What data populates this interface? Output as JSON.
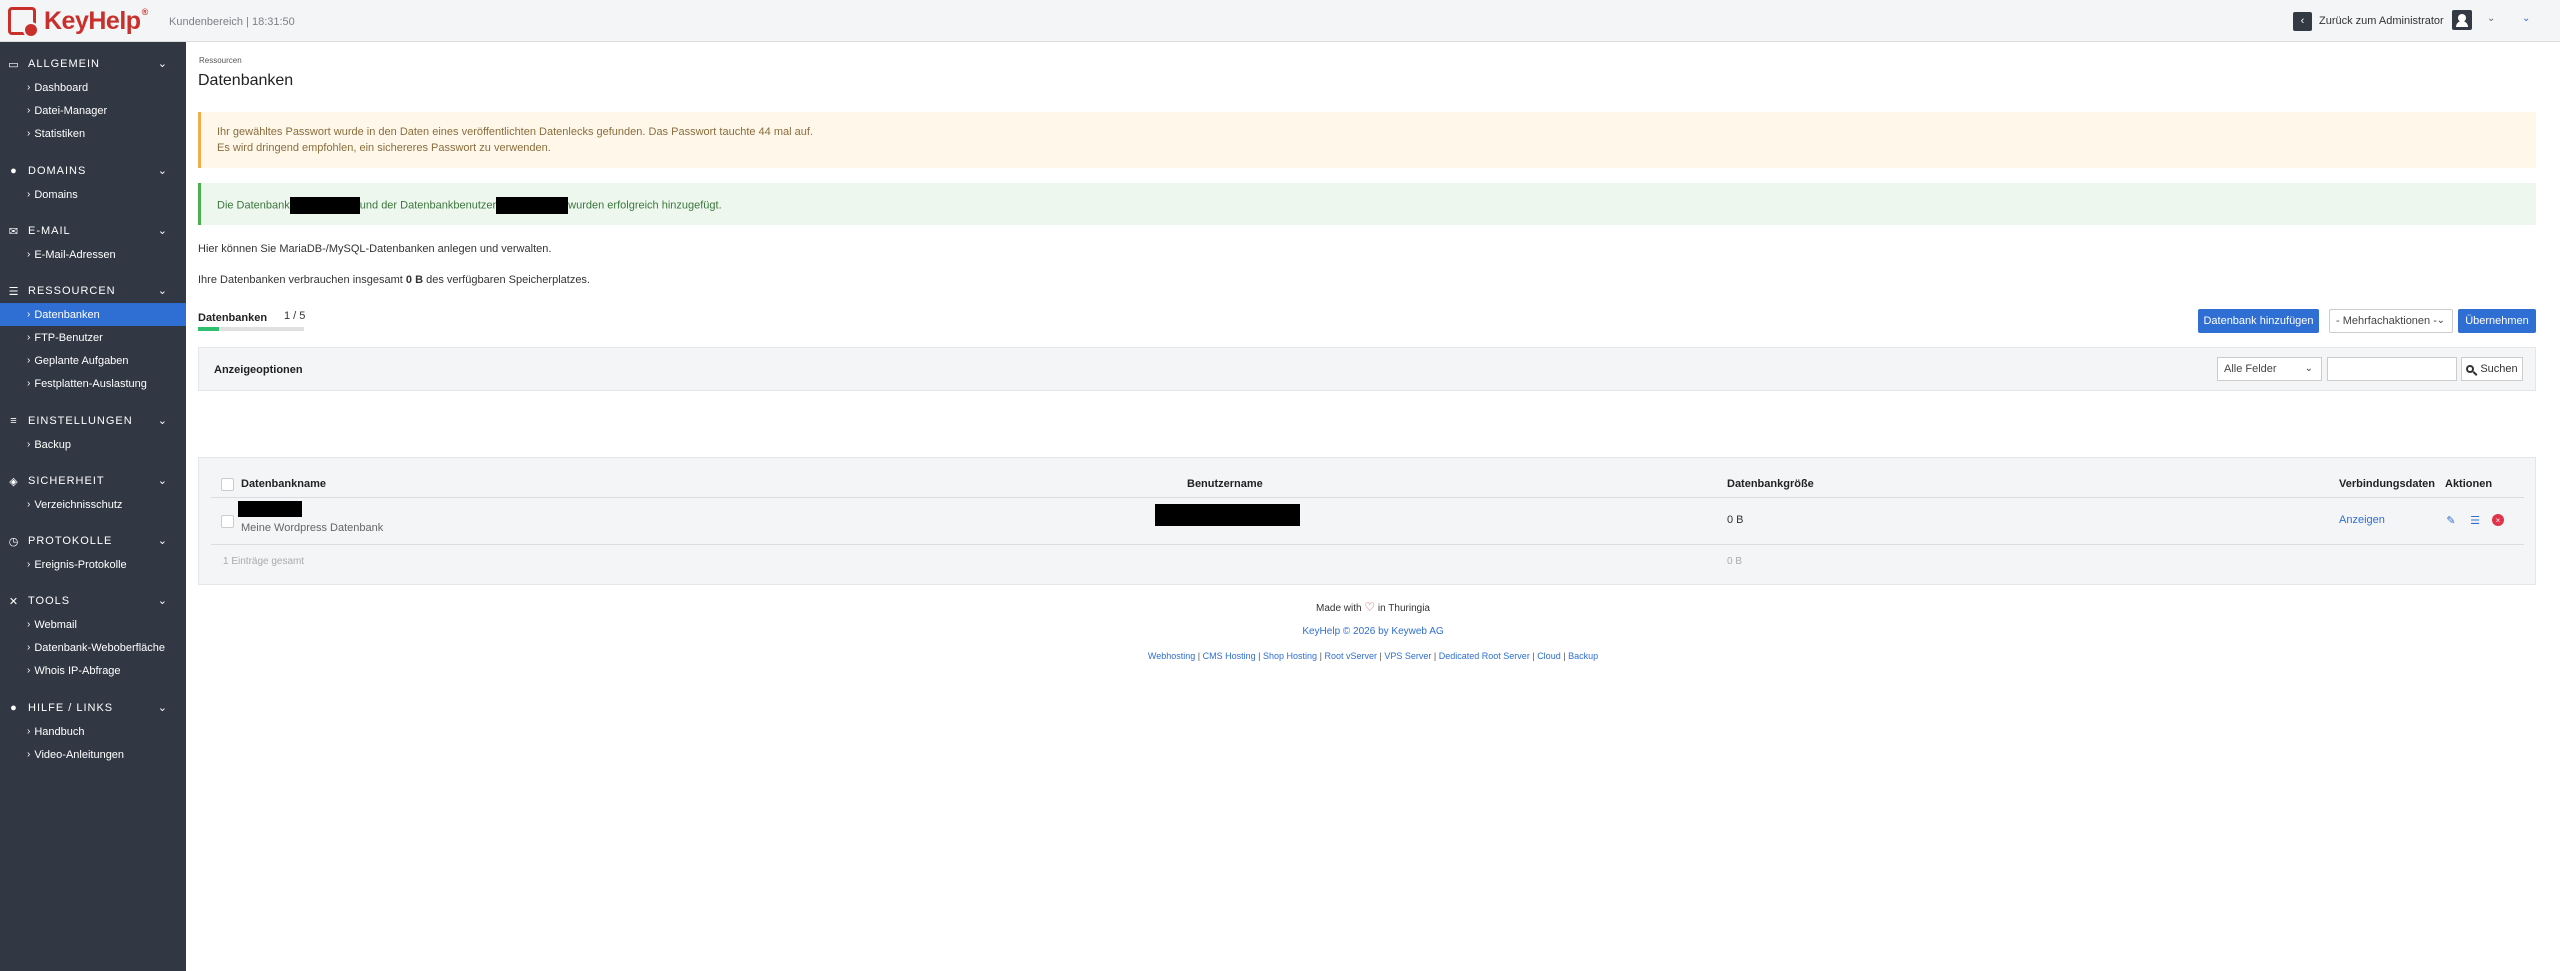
{
  "topbar": {
    "logo_text_1": "Key",
    "logo_text_2": "Help",
    "logo_reg": "®",
    "area_info": "Kundenbereich | 18:31:50",
    "back_admin": "Zurück zum Administrator"
  },
  "sidebar": {
    "groups": [
      {
        "title": "Allgemein",
        "icon": "monitor-icon",
        "items": [
          "Dashboard",
          "Datei-Manager",
          "Statistiken"
        ]
      },
      {
        "title": "Domains",
        "icon": "globe-icon",
        "items": [
          "Domains"
        ]
      },
      {
        "title": "E-Mail",
        "icon": "envelope-icon",
        "items": [
          "E-Mail-Adressen"
        ]
      },
      {
        "title": "Ressourcen",
        "icon": "database-icon",
        "items": [
          "Datenbanken",
          "FTP-Benutzer",
          "Geplante Aufgaben",
          "Festplatten-Auslastung"
        ]
      },
      {
        "title": "Einstellungen",
        "icon": "sliders-icon",
        "items": [
          "Backup"
        ]
      },
      {
        "title": "Sicherheit",
        "icon": "shield-icon",
        "items": [
          "Verzeichnisschutz"
        ]
      },
      {
        "title": "Protokolle",
        "icon": "clock-icon",
        "items": [
          "Ereignis-Protokolle"
        ]
      },
      {
        "title": "Tools",
        "icon": "tools-icon",
        "items": [
          "Webmail",
          "Datenbank-Weboberfläche",
          "Whois IP-Abfrage"
        ]
      },
      {
        "title": "Hilfe / Links",
        "icon": "question-icon",
        "items": [
          "Handbuch",
          "Video-Anleitungen"
        ]
      }
    ],
    "active_item": "Datenbanken"
  },
  "main": {
    "breadcrumb": "Ressourcen",
    "title": "Datenbanken",
    "warning_line1": "Ihr gewähltes Passwort wurde in den Daten eines veröffentlichten Datenlecks gefunden. Das Passwort tauchte 44 mal auf.",
    "warning_line2": "Es wird dringend empfohlen, ein sichereres Passwort zu verwenden.",
    "success_part1": "Die Datenbank",
    "success_part2": "und der Datenbankbenutzer",
    "success_part3": "wurden erfolgreich hinzugefügt.",
    "info_line1": "Hier können Sie MariaDB-/MySQL-Datenbanken anlegen und verwalten.",
    "info_line2_pre": "Ihre Datenbanken verbrauchen insgesamt",
    "info_line2_bold": "0 B",
    "info_line2_post": "des verfügbaren Speicherplatzes.",
    "quota_label": "Datenbanken",
    "quota_count": "1 / 5",
    "quota_fraction": 0.2,
    "add_button": "Datenbank hinzufügen",
    "bulk_select": "- Mehrfachaktionen -",
    "apply_button": "Übernehmen",
    "options_title": "Anzeigeoptionen",
    "fields_select": "Alle Felder",
    "search_placeholder": "",
    "search_button": "Suchen",
    "table": {
      "headers": [
        "Datenbankname",
        "Benutzername",
        "Datenbankgröße",
        "Verbindungsdaten",
        "Aktionen"
      ],
      "rows": [
        {
          "description": "Meine Wordpress Datenbank",
          "size": "0 B",
          "connection": "Anzeigen"
        }
      ],
      "total_label": "1 Einträge gesamt",
      "total_size": "0 B"
    }
  },
  "footer": {
    "made_with_pre": "Made with",
    "made_with_post": "in Thuringia",
    "copyright": "KeyHelp © 2026 by Keyweb AG",
    "links": [
      "Webhosting",
      "CMS Hosting",
      "Shop Hosting",
      "Root vServer",
      "VPS Server",
      "Dedicated Root Server",
      "Cloud",
      "Backup"
    ]
  },
  "colors": {
    "accent": "#2f6ed3",
    "sidebar_bg": "#313843",
    "brand": "#c9302c",
    "warning_bg": "#fff8ea",
    "success_bg": "#edf7ee"
  }
}
